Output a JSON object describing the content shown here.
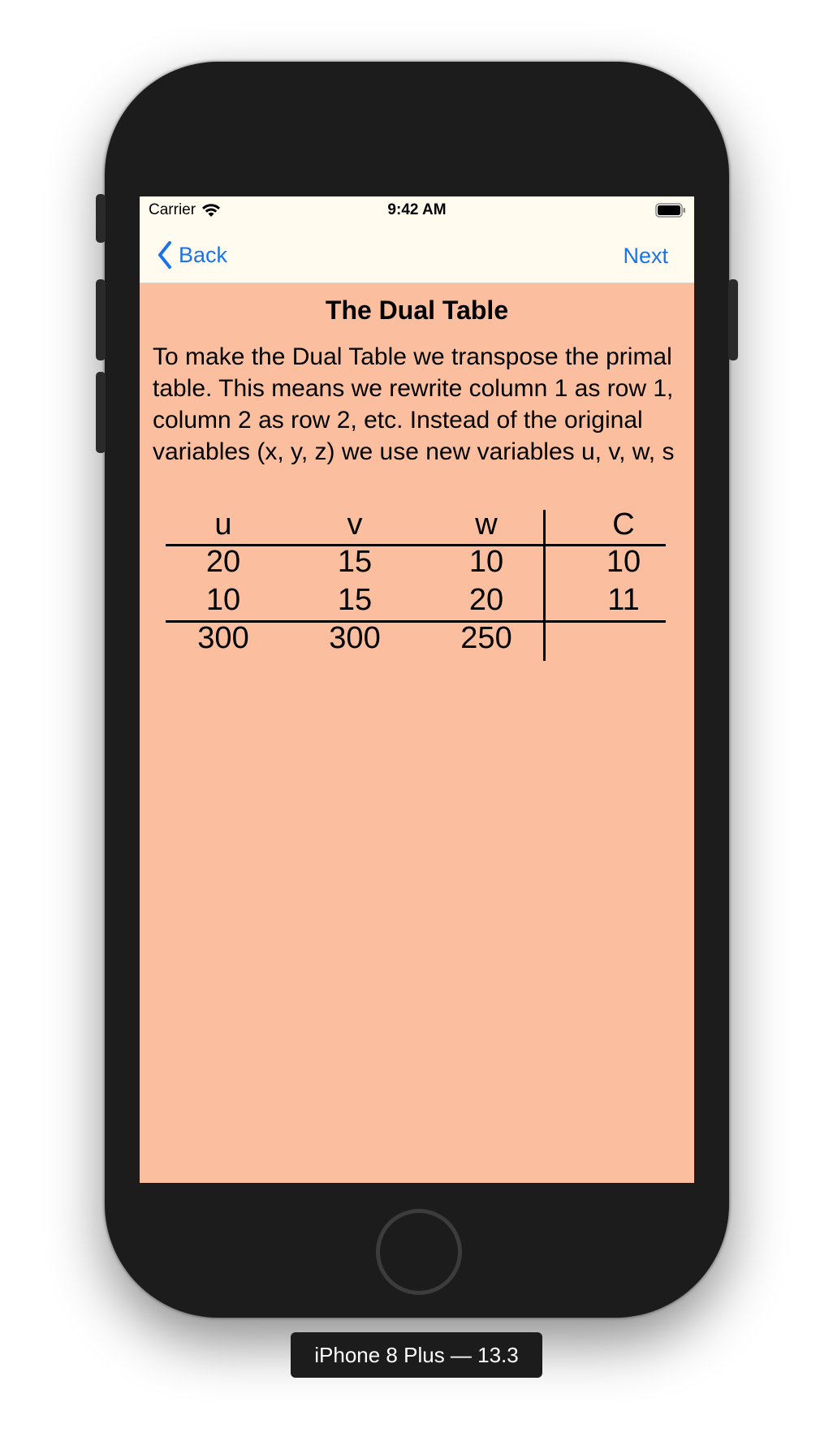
{
  "status_bar": {
    "carrier": "Carrier",
    "time": "9:42 AM",
    "wifi_icon": "wifi-icon",
    "battery_icon": "battery-icon"
  },
  "nav": {
    "back_label": "Back",
    "next_label": "Next",
    "back_icon": "chevron-left-icon",
    "accent_color": "#1a73e8"
  },
  "main": {
    "title": "The Dual Table",
    "intro": "To make the Dual Table we transpose the primal table.  This means we rewrite column 1 as row 1, column 2 as row 2, etc.  Instead of the original variables (x, y, z) we use new variables u, v, w, s",
    "background_color": "#fbbf9f"
  },
  "table": {
    "headers": [
      "u",
      "v",
      "w",
      "C"
    ],
    "rows": [
      [
        "20",
        "15",
        "10",
        "10"
      ],
      [
        "10",
        "15",
        "20",
        "11"
      ],
      [
        "300",
        "300",
        "250",
        ""
      ]
    ]
  },
  "device": {
    "label": "iPhone 8 Plus — 13.3"
  }
}
